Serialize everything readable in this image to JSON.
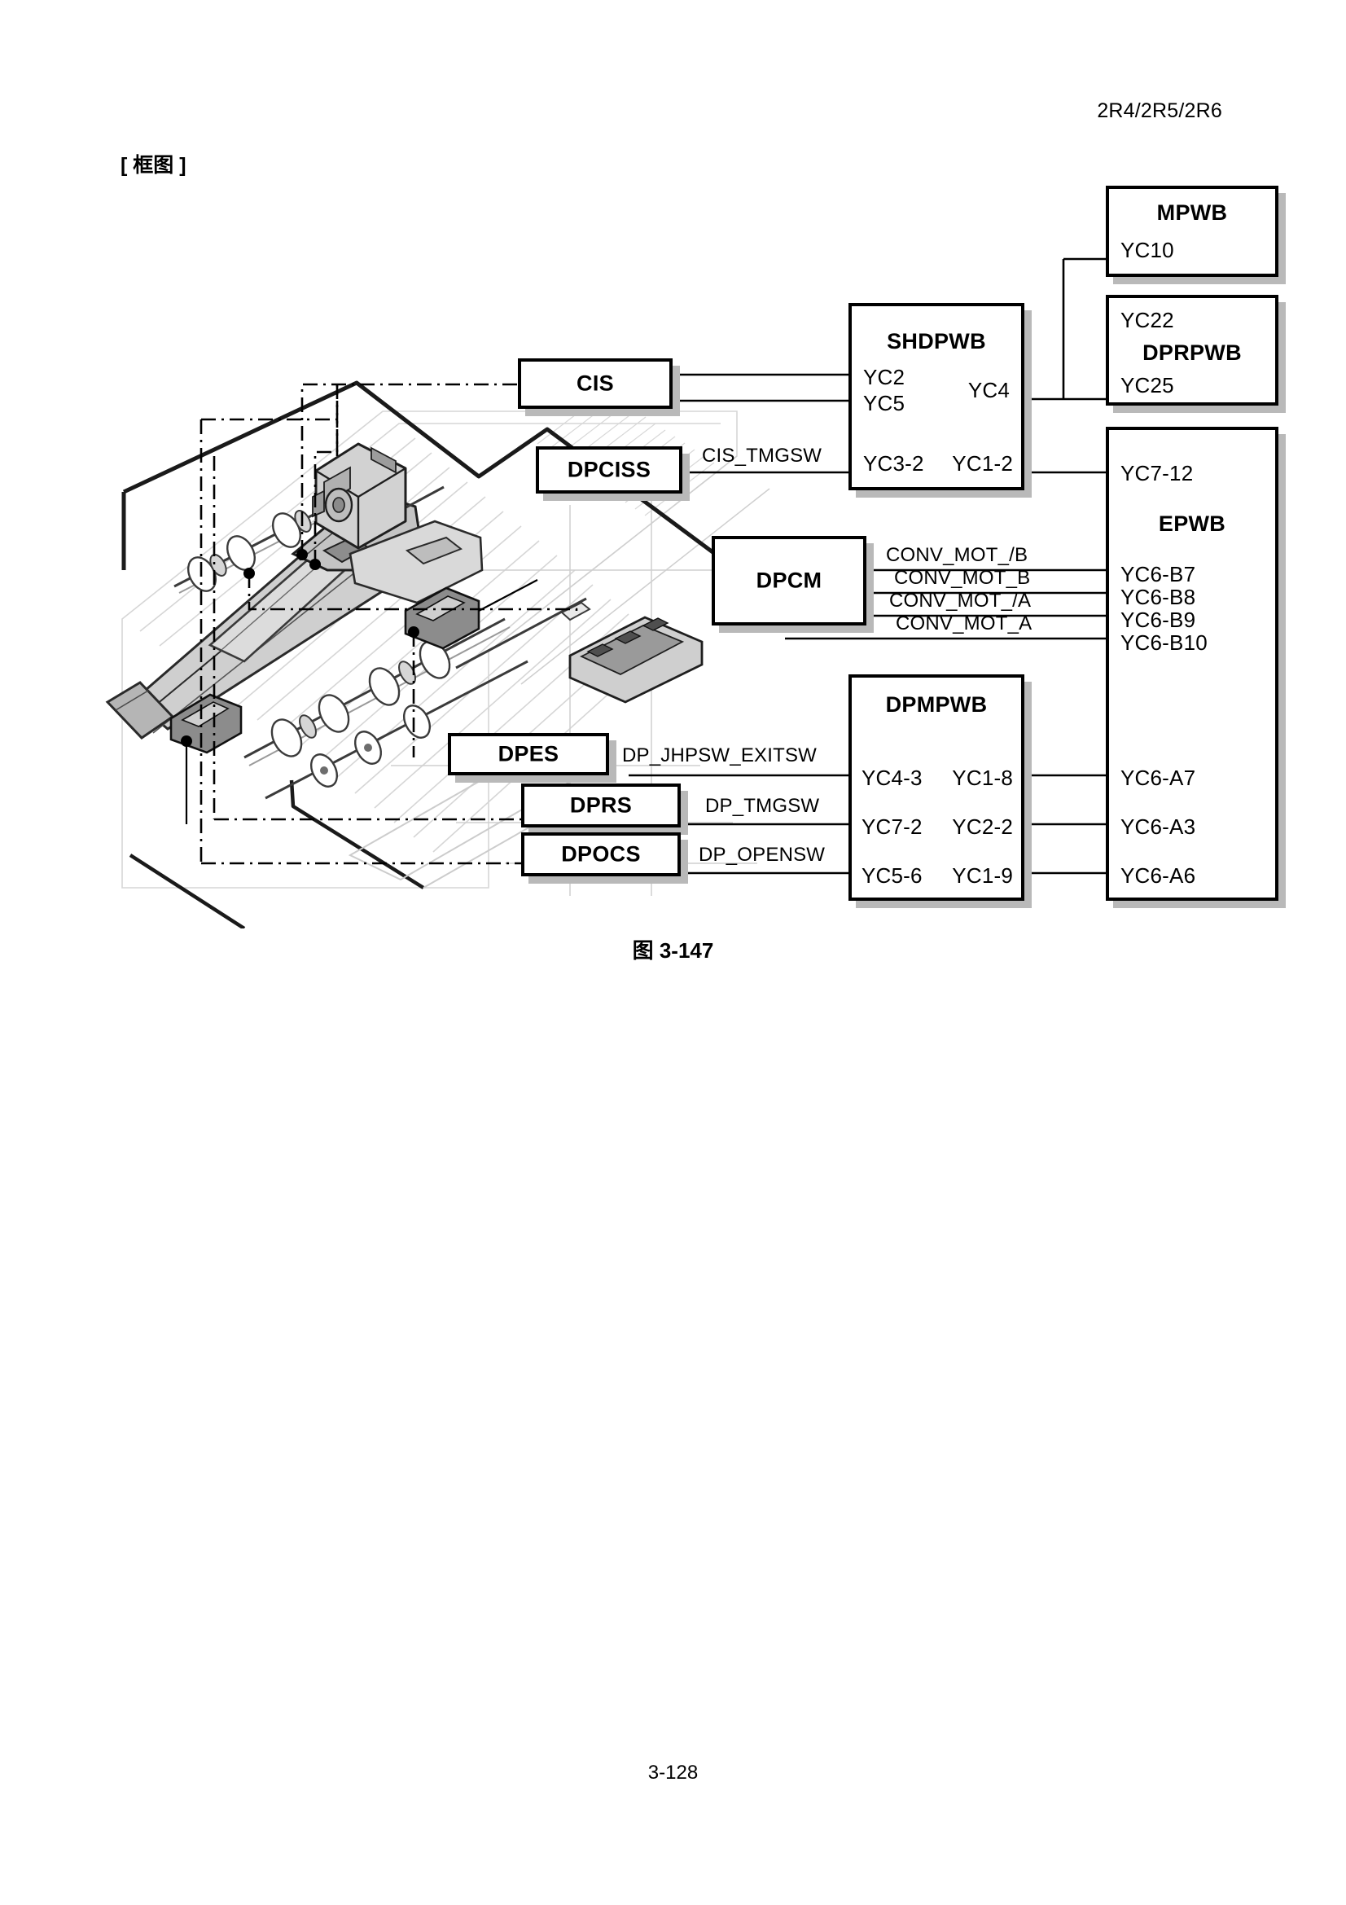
{
  "header": {
    "model": "2R4/2R5/2R6"
  },
  "section": {
    "tag": "[ 框图 ]"
  },
  "figure": {
    "caption": "图 3-147"
  },
  "footer": {
    "page": "3-128"
  },
  "blocks": {
    "cis": {
      "title": "CIS",
      "pins": []
    },
    "dpciss": {
      "title": "DPCISS",
      "pins": []
    },
    "dpcm": {
      "title": "DPCM",
      "pins": []
    },
    "dpes": {
      "title": "DPES",
      "pins": []
    },
    "dprs": {
      "title": "DPRS",
      "pins": []
    },
    "dpocs": {
      "title": "DPOCS",
      "pins": []
    },
    "shdpwb": {
      "title": "SHDPWB",
      "pin_yc2": "YC2",
      "pin_yc5": "YC5",
      "pin_yc4": "YC4",
      "pin_yc3_2": "YC3-2",
      "pin_yc1_2": "YC1-2"
    },
    "dpmpwb": {
      "title": "DPMPWB",
      "pin_yc4_3": "YC4-3",
      "pin_yc1_8": "YC1-8",
      "pin_yc7_2": "YC7-2",
      "pin_yc2_2": "YC2-2",
      "pin_yc5_6": "YC5-6",
      "pin_yc1_9": "YC1-9"
    },
    "mpwb": {
      "title": "MPWB",
      "pin_yc10": "YC10"
    },
    "dprpwb": {
      "title": "DPRPWB",
      "pin_yc22": "YC22",
      "pin_yc25": "YC25"
    },
    "epwb": {
      "title": "EPWB",
      "pin_yc7_12": "YC7-12",
      "pin_yc6_b7": "YC6-B7",
      "pin_yc6_b8": "YC6-B8",
      "pin_yc6_b9": "YC6-B9",
      "pin_yc6_b10": "YC6-B10",
      "pin_yc6_a7": "YC6-A7",
      "pin_yc6_a3": "YC6-A3",
      "pin_yc6_a6": "YC6-A6"
    }
  },
  "signals": {
    "cis_tmgsw": "CIS_TMGSW",
    "conv_mot_nb": "CONV_MOT_/B",
    "conv_mot_b": "CONV_MOT_B",
    "conv_mot_na": "CONV_MOT_/A",
    "conv_mot_a": "CONV_MOT_A",
    "dp_jhpsw_exitsw": "DP_JHPSW_EXITSW",
    "dp_tmgsw": "DP_TMGSW",
    "dp_opensw": "DP_OPENSW"
  },
  "colors": {
    "line": "#000000",
    "shadow": "#b9b9b9",
    "illustration_light": "#d0d0d0",
    "illustration_mid": "#a8a8a8",
    "illustration_dark": "#6e6e6e",
    "paper": "#ffffff"
  }
}
